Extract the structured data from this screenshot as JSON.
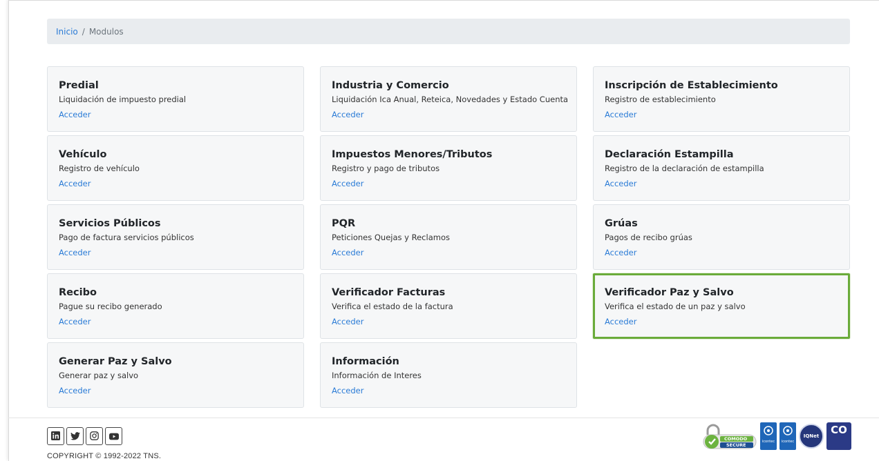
{
  "breadcrumb": {
    "home": "Inicio",
    "separator": "/",
    "current": "Modulos"
  },
  "modules": [
    {
      "title": "Predial",
      "desc": "Liquidación de impuesto predial",
      "link": "Acceder"
    },
    {
      "title": "Industria y Comercio",
      "desc": "Liquidación Ica Anual, Reteica, Novedades y Estado Cuenta",
      "link": "Acceder"
    },
    {
      "title": "Inscripción de Establecimiento",
      "desc": "Registro de establecimiento",
      "link": "Acceder"
    },
    {
      "title": "Vehículo",
      "desc": "Registro de vehículo",
      "link": "Acceder"
    },
    {
      "title": "Impuestos Menores/Tributos",
      "desc": "Registro y pago de tributos",
      "link": "Acceder"
    },
    {
      "title": "Declaración Estampilla",
      "desc": "Registro de la declaración de estampilla",
      "link": "Acceder"
    },
    {
      "title": "Servicios Públicos",
      "desc": "Pago de factura servicios públicos",
      "link": "Acceder"
    },
    {
      "title": "PQR",
      "desc": "Peticiones Quejas y Reclamos",
      "link": "Acceder"
    },
    {
      "title": "Grúas",
      "desc": "Pagos de recibo grúas",
      "link": "Acceder"
    },
    {
      "title": "Recibo",
      "desc": "Pague su recibo generado",
      "link": "Acceder"
    },
    {
      "title": "Verificador Facturas",
      "desc": "Verifica el estado de la factura",
      "link": "Acceder"
    },
    {
      "title": "Verificador Paz y Salvo",
      "desc": "Verifica el estado de un paz y salvo",
      "link": "Acceder"
    },
    {
      "title": "Generar Paz y Salvo",
      "desc": "Generar paz y salvo",
      "link": "Acceder"
    },
    {
      "title": "Información",
      "desc": "Información de Interes",
      "link": "Acceder"
    }
  ],
  "highlight_color": "#6aab3a",
  "link_color": "#2a7bd6",
  "footer": {
    "socials": [
      "linkedin-icon",
      "twitter-icon",
      "instagram-icon",
      "youtube-icon"
    ],
    "copyright": "COPYRIGHT © 1992-2022 TNS.",
    "badges": {
      "comodo_top": "COMODO",
      "comodo_bottom": "SECURE",
      "icontec1": "icontec",
      "icontec2": "icontec",
      "iqnet": "IQNet",
      "co": "CO"
    }
  }
}
